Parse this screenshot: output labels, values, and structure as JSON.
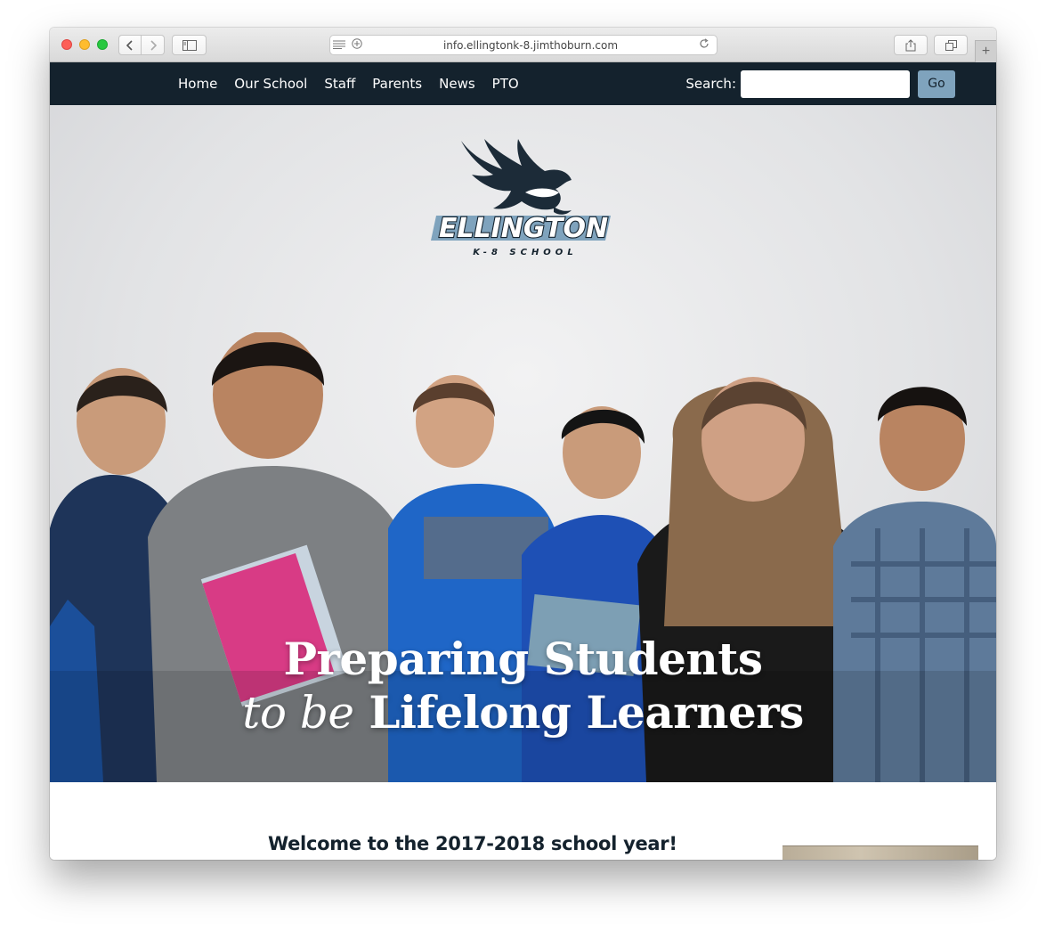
{
  "browser": {
    "url": "info.ellingtonk-8.jimthoburn.com",
    "icons": [
      "back-arrow-icon",
      "forward-arrow-icon",
      "sidebar-icon",
      "reader-icon",
      "extensions-icon",
      "reload-icon",
      "share-icon",
      "tabs-icon",
      "plus-icon"
    ]
  },
  "nav": {
    "items": [
      "Home",
      "Our School",
      "Staff",
      "Parents",
      "News",
      "PTO"
    ],
    "search_label": "Search:",
    "search_value": "",
    "search_button": "Go"
  },
  "hero": {
    "logo_text": "ELLINGTON",
    "logo_subtext": "K-8 SCHOOL",
    "headline_line1": "Preparing Students",
    "headline_line2_italic": "to be",
    "headline_line2_rest": "Lifelong Learners"
  },
  "content": {
    "welcome_heading": "Welcome to the 2017-2018 school year!"
  },
  "colors": {
    "nav_bg": "#14222d",
    "button_bg": "#7fa3bd",
    "heading": "#14222d"
  }
}
